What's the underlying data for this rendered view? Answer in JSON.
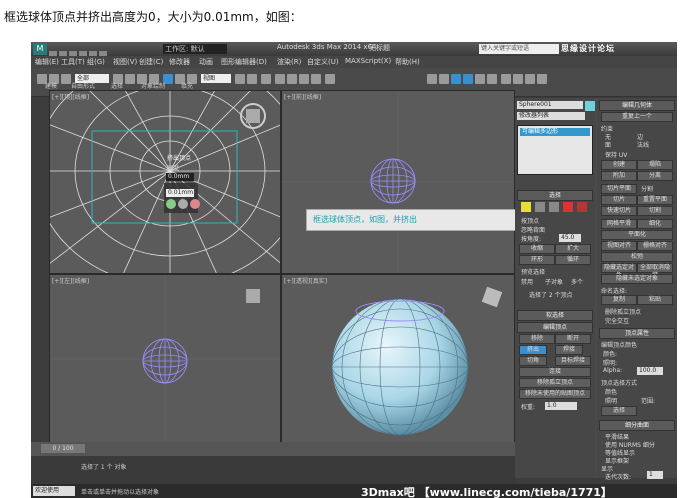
{
  "caption": "框选球体顶点并挤出高度为0，大小为0.01mm，如图：",
  "app": {
    "workspace": "工作区: 默认",
    "title": "Autodesk 3ds Max 2014 x64",
    "filename": "无标题",
    "search_placeholder": "键入关键字或短语",
    "watermark_top": "思缘设计论坛"
  },
  "menu": [
    "编辑(E)",
    "工具(T)",
    "组(G)",
    "视图(V)",
    "创建(C)",
    "修改器",
    "动画",
    "图形编辑器(D)",
    "渲染(R)",
    "自定义(U)",
    "MAXScript(X)",
    "帮助(H)"
  ],
  "toolbar": {
    "filter": "全部",
    "refcoord": "视图"
  },
  "ribbon_tabs": [
    "建模",
    "自由形式",
    "选择",
    "对象绘制",
    "填充"
  ],
  "viewports": {
    "top_left": "[+][顶][线框]",
    "top_right": "[+][前][线框]",
    "bottom_left": "[+][左][线框]",
    "bottom_right": "[+][透视][真实]"
  },
  "caddy": {
    "title": "挤出顶点",
    "height_label": "高度",
    "height_value": "0.0mm",
    "width_label": "宽度",
    "width_value": "0.01mm"
  },
  "tooltip": "框选球体顶点，如图，并挤出",
  "command_panel": {
    "object_name": "Sphere001",
    "modifier_list": "修改器列表",
    "stack_item": "可编辑多边形",
    "selection": {
      "header": "选择",
      "by_vertex": "按顶点",
      "ignore_backfacing": "忽略背面",
      "by_angle": "按角度:",
      "angle_value": "45.0",
      "shrink": "收缩",
      "grow": "扩大",
      "ring": "环形",
      "loop": "循环",
      "preview_selection": "预览选择",
      "disabled": "禁用",
      "subobject": "子对象",
      "multi": "多个",
      "status": "选择了 2 个顶点"
    },
    "soft_selection": {
      "header": "软选择"
    },
    "edit_vertices": {
      "header": "编辑顶点",
      "remove": "移除",
      "break": "断开",
      "extrude": "挤出",
      "weld": "焊接",
      "chamfer": "切角",
      "target_weld": "目标焊接",
      "connect": "连接",
      "remove_isolated": "移除孤立顶点",
      "remove_unused_map": "移除未使用的贴图顶点",
      "weight_label": "权重:",
      "weight_value": "1.0"
    },
    "edit_geometry": {
      "header": "编辑几何体",
      "repeat_last": "重复上一个",
      "constraints": "约束",
      "none": "无",
      "edge": "边",
      "face": "面",
      "normal": "法线",
      "preserve_uv": "保持 UV",
      "create": "创建",
      "collapse": "塌陷",
      "attach": "附加",
      "detach": "分离",
      "slice_plane": "切片平面",
      "split": "分割",
      "slice": "切片",
      "reset_plane": "重置平面",
      "quickslice": "快速切片",
      "cut": "切割",
      "meshsmooth": "网格平滑",
      "tessellate": "细化",
      "make_planar": "平面化",
      "view_align": "视图对齐",
      "grid_align": "栅格对齐",
      "relax": "松弛",
      "hide_selected": "隐藏选定对象",
      "unhide_all": "全部取消隐藏",
      "hide_unselected": "隐藏未选定对象",
      "named_selections": "命名选择:",
      "copy": "复制",
      "paste": "粘贴",
      "delete_isolated": "删除孤立顶点",
      "full_interactivity": "完全交互"
    },
    "vertex_properties": {
      "header": "顶点属性",
      "edit_vertex_colors": "编辑顶点颜色",
      "color": "颜色:",
      "illumination": "照明:",
      "alpha": "Alpha:",
      "alpha_value": "100.0",
      "select_by": "顶点选择方式",
      "color_opt": "颜色",
      "illum_opt": "照明",
      "range": "范围:",
      "select_btn": "选择"
    },
    "subdivision": {
      "header": "细分曲面",
      "smooth_result": "平滑结果",
      "use_nurms": "使用 NURMS 细分",
      "isoline_display": "等值线显示",
      "show_cage": "显示框架",
      "display": "显示",
      "iterations_label": "迭代次数:",
      "iterations_value": "1",
      "smoothness_label": "平滑度:",
      "smoothness_value": "1.0"
    }
  },
  "timeline": {
    "frame": "0 / 100"
  },
  "status": {
    "welcome": "欢迎使用 MAXSc",
    "selected": "选择了 1 个 对象",
    "hint": "单击或单击并拖动以选择对象",
    "add_time_tag": "添加时间标记",
    "key_filter": "关键点过滤器..."
  },
  "watermark_bottom": "3Dmax吧 【www.linecg.com/tieba/1771】",
  "colors": {
    "viewport_bg": "#5b5b5b",
    "grid_line": "#6a6a6a",
    "wire_white": "#e0e0e0",
    "sphere_wire": "#9a8cff",
    "selection_box": "#27b7c0",
    "shaded_sphere": "#a9d6e6"
  }
}
